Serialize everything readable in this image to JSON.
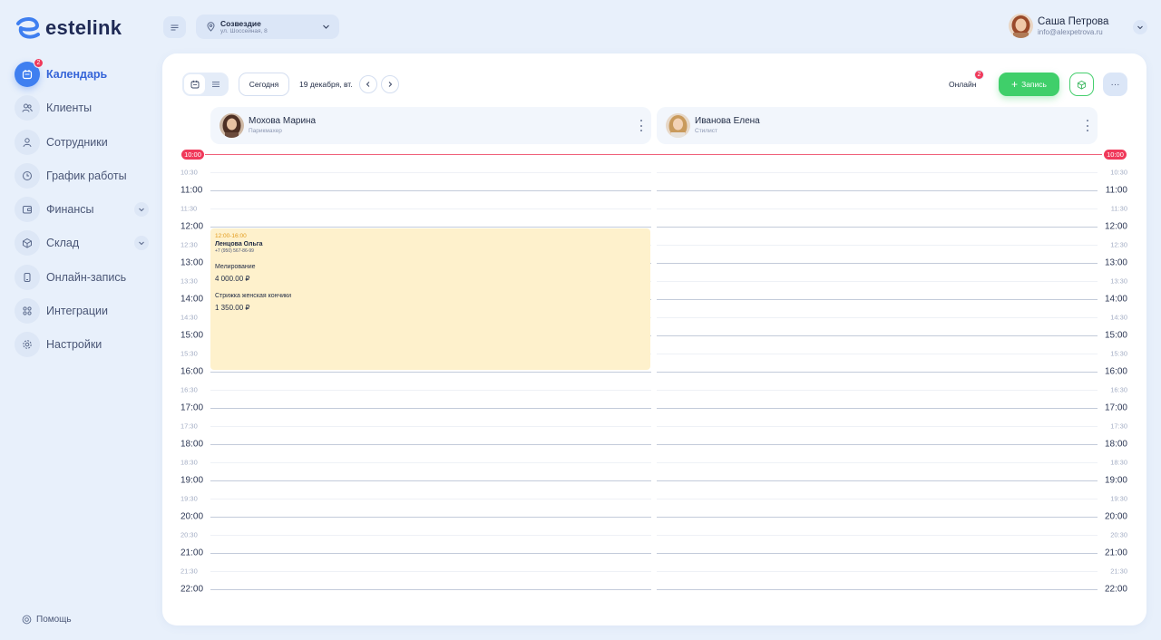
{
  "brand": {
    "name": "estelink"
  },
  "sidebar": {
    "items": [
      {
        "label": "Календарь",
        "icon": "calendar-icon",
        "active": true,
        "badge": "2"
      },
      {
        "label": "Клиенты",
        "icon": "users-icon"
      },
      {
        "label": "Сотрудники",
        "icon": "user-icon"
      },
      {
        "label": "График работы",
        "icon": "clock-icon"
      },
      {
        "label": "Финансы",
        "icon": "wallet-icon",
        "expandable": true
      },
      {
        "label": "Склад",
        "icon": "box-icon",
        "expandable": true
      },
      {
        "label": "Онлайн-запись",
        "icon": "phone-icon"
      },
      {
        "label": "Интеграции",
        "icon": "grid-icon"
      },
      {
        "label": "Настройки",
        "icon": "gear-icon"
      }
    ],
    "help_label": "Помощь"
  },
  "header": {
    "location": {
      "name": "Созвездие",
      "address": "ул. Шоссейная, 8"
    },
    "user": {
      "name": "Саша Петрова",
      "email": "info@alexpetrova.ru"
    }
  },
  "toolbar": {
    "today_label": "Сегодня",
    "date_label": "19 декабря, вт.",
    "online_label": "Онлайн",
    "online_badge": "2",
    "add_label": "Запись",
    "more_label": "···"
  },
  "staff": [
    {
      "name": "Мохова Марина",
      "role": "Парикмахер"
    },
    {
      "name": "Иванова Елена",
      "role": "Стилист"
    }
  ],
  "schedule": {
    "now_label": "10:00",
    "times": [
      "10:30",
      "11:00",
      "11:30",
      "12:00",
      "12:30",
      "13:00",
      "13:30",
      "14:00",
      "14:30",
      "15:00",
      "15:30",
      "16:00",
      "16:30",
      "17:00",
      "17:30",
      "18:00",
      "18:30",
      "19:00",
      "19:30",
      "20:00",
      "20:30",
      "21:00",
      "21:30",
      "22:00"
    ]
  },
  "appointment": {
    "time": "12:00-16:00",
    "client": "Ленцова Ольга",
    "phone": "+7 (950) 567-86-99",
    "services": [
      {
        "name": "Мелирование",
        "price": "4 000.00 ₽"
      },
      {
        "name": "Стрижка женская кончики",
        "price": "1 350.00 ₽"
      }
    ]
  },
  "colors": {
    "accent": "#3f7ff0",
    "success": "#3fcf6a",
    "danger": "#f0395a",
    "appointment_bg": "#fef1cc",
    "appointment_time": "#e29a1c"
  }
}
